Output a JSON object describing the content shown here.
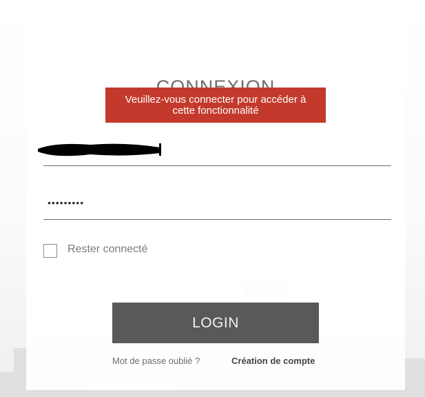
{
  "login": {
    "title": "CONNEXION",
    "alert_message": "Veuillez-vous connecter pour accéder à cette fonctionnalité",
    "username_value": "",
    "password_value": "•••••••••",
    "remember_label": "Rester connecté",
    "remember_checked": false,
    "login_button": "LOGIN",
    "forgot_password_link": "Mot de passe oublié ?",
    "create_account_link": "Création de compte"
  },
  "colors": {
    "alert_background": "#c33a2c",
    "button_background": "#58595b"
  }
}
